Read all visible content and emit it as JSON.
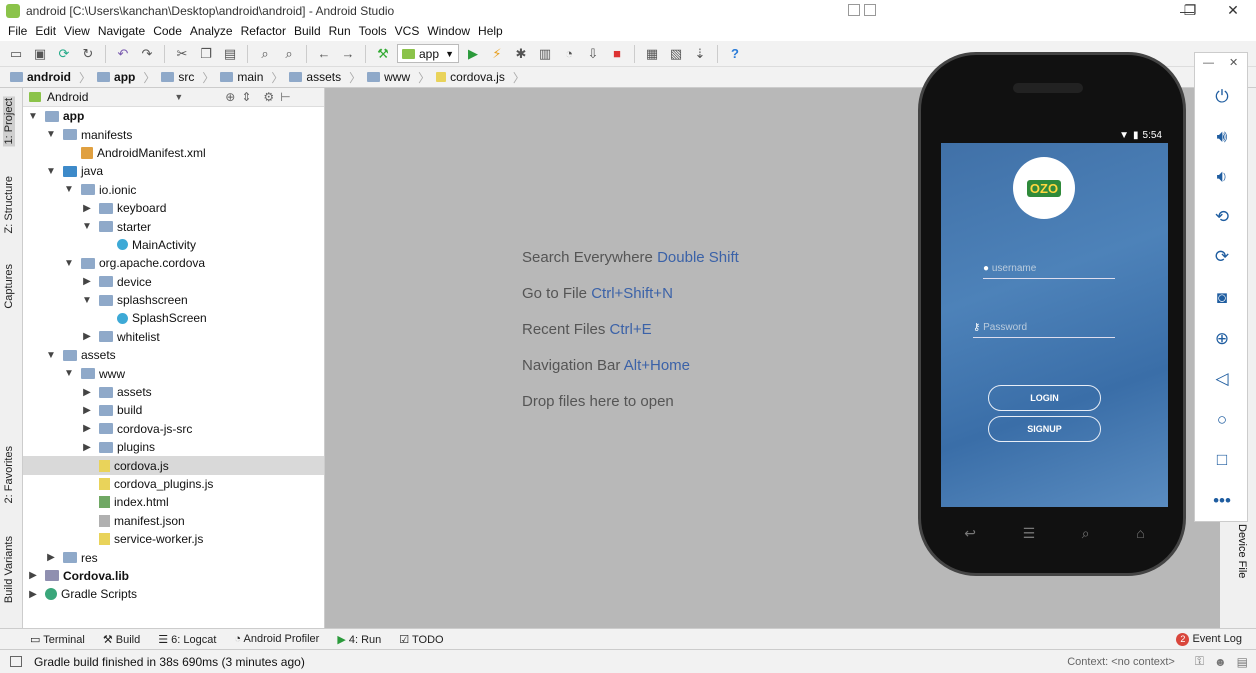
{
  "window": {
    "title": "android [C:\\Users\\kanchan\\Desktop\\android\\android] - Android Studio",
    "min": "—",
    "max": "❐",
    "close": "✕"
  },
  "menu": [
    "File",
    "Edit",
    "View",
    "Navigate",
    "Code",
    "Analyze",
    "Refactor",
    "Build",
    "Run",
    "Tools",
    "VCS",
    "Window",
    "Help"
  ],
  "toolbar": {
    "run_config": "app"
  },
  "breadcrumbs": [
    "android",
    "app",
    "src",
    "main",
    "assets",
    "www",
    "cordova.js"
  ],
  "left_tabs": [
    "1: Project",
    "Z: Structure",
    "Captures",
    "2: Favorites",
    "Build Variants"
  ],
  "project_panel": {
    "view": "Android"
  },
  "tree": [
    {
      "label": "app",
      "depth": 0,
      "arrow": "v",
      "icon": "folder",
      "bold": true
    },
    {
      "label": "manifests",
      "depth": 1,
      "arrow": "v",
      "icon": "folder"
    },
    {
      "label": "AndroidManifest.xml",
      "depth": 2,
      "arrow": "",
      "icon": "xml"
    },
    {
      "label": "java",
      "depth": 1,
      "arrow": "v",
      "icon": "java"
    },
    {
      "label": "io.ionic",
      "depth": 2,
      "arrow": "v",
      "icon": "folder"
    },
    {
      "label": "keyboard",
      "depth": 3,
      "arrow": ">",
      "icon": "folder"
    },
    {
      "label": "starter",
      "depth": 3,
      "arrow": "v",
      "icon": "folder"
    },
    {
      "label": "MainActivity",
      "depth": 4,
      "arrow": "",
      "icon": "cls"
    },
    {
      "label": "org.apache.cordova",
      "depth": 2,
      "arrow": "v",
      "icon": "folder"
    },
    {
      "label": "device",
      "depth": 3,
      "arrow": ">",
      "icon": "folder"
    },
    {
      "label": "splashscreen",
      "depth": 3,
      "arrow": "v",
      "icon": "folder"
    },
    {
      "label": "SplashScreen",
      "depth": 4,
      "arrow": "",
      "icon": "cls"
    },
    {
      "label": "whitelist",
      "depth": 3,
      "arrow": ">",
      "icon": "folder"
    },
    {
      "label": "assets",
      "depth": 1,
      "arrow": "v",
      "icon": "folder"
    },
    {
      "label": "www",
      "depth": 2,
      "arrow": "v",
      "icon": "folder"
    },
    {
      "label": "assets",
      "depth": 3,
      "arrow": ">",
      "icon": "folder"
    },
    {
      "label": "build",
      "depth": 3,
      "arrow": ">",
      "icon": "folder"
    },
    {
      "label": "cordova-js-src",
      "depth": 3,
      "arrow": ">",
      "icon": "folder"
    },
    {
      "label": "plugins",
      "depth": 3,
      "arrow": ">",
      "icon": "folder"
    },
    {
      "label": "cordova.js",
      "depth": 3,
      "arrow": "",
      "icon": "js",
      "selected": true
    },
    {
      "label": "cordova_plugins.js",
      "depth": 3,
      "arrow": "",
      "icon": "js"
    },
    {
      "label": "index.html",
      "depth": 3,
      "arrow": "",
      "icon": "html"
    },
    {
      "label": "manifest.json",
      "depth": 3,
      "arrow": "",
      "icon": "json"
    },
    {
      "label": "service-worker.js",
      "depth": 3,
      "arrow": "",
      "icon": "js"
    },
    {
      "label": "res",
      "depth": 1,
      "arrow": ">",
      "icon": "folder"
    },
    {
      "label": "Cordova.lib",
      "depth": 0,
      "arrow": ">",
      "icon": "lib",
      "bold": true
    },
    {
      "label": "Gradle Scripts",
      "depth": 0,
      "arrow": ">",
      "icon": "gradle"
    }
  ],
  "editor_hints": [
    {
      "text": "Search Everywhere",
      "key": "Double Shift"
    },
    {
      "text": "Go to File",
      "key": "Ctrl+Shift+N"
    },
    {
      "text": "Recent Files",
      "key": "Ctrl+E"
    },
    {
      "text": "Navigation Bar",
      "key": "Alt+Home"
    },
    {
      "text": "Drop files here to open",
      "key": ""
    }
  ],
  "bottom_tabs": [
    "Terminal",
    "Build",
    "6: Logcat",
    "Android Profiler",
    "4: Run",
    "TODO"
  ],
  "event_log": {
    "count": "2",
    "label": "Event Log"
  },
  "status": {
    "message": "Gradle build finished in 38s 690ms (3 minutes ago)",
    "context": "Context: <no context>"
  },
  "right_tab": "Device File",
  "emulator": {
    "time": "5:54",
    "logo_text": "OZO",
    "username_placeholder": "username",
    "password_placeholder": "Password",
    "login_label": "LOGIN",
    "signup_label": "SIGNUP"
  }
}
